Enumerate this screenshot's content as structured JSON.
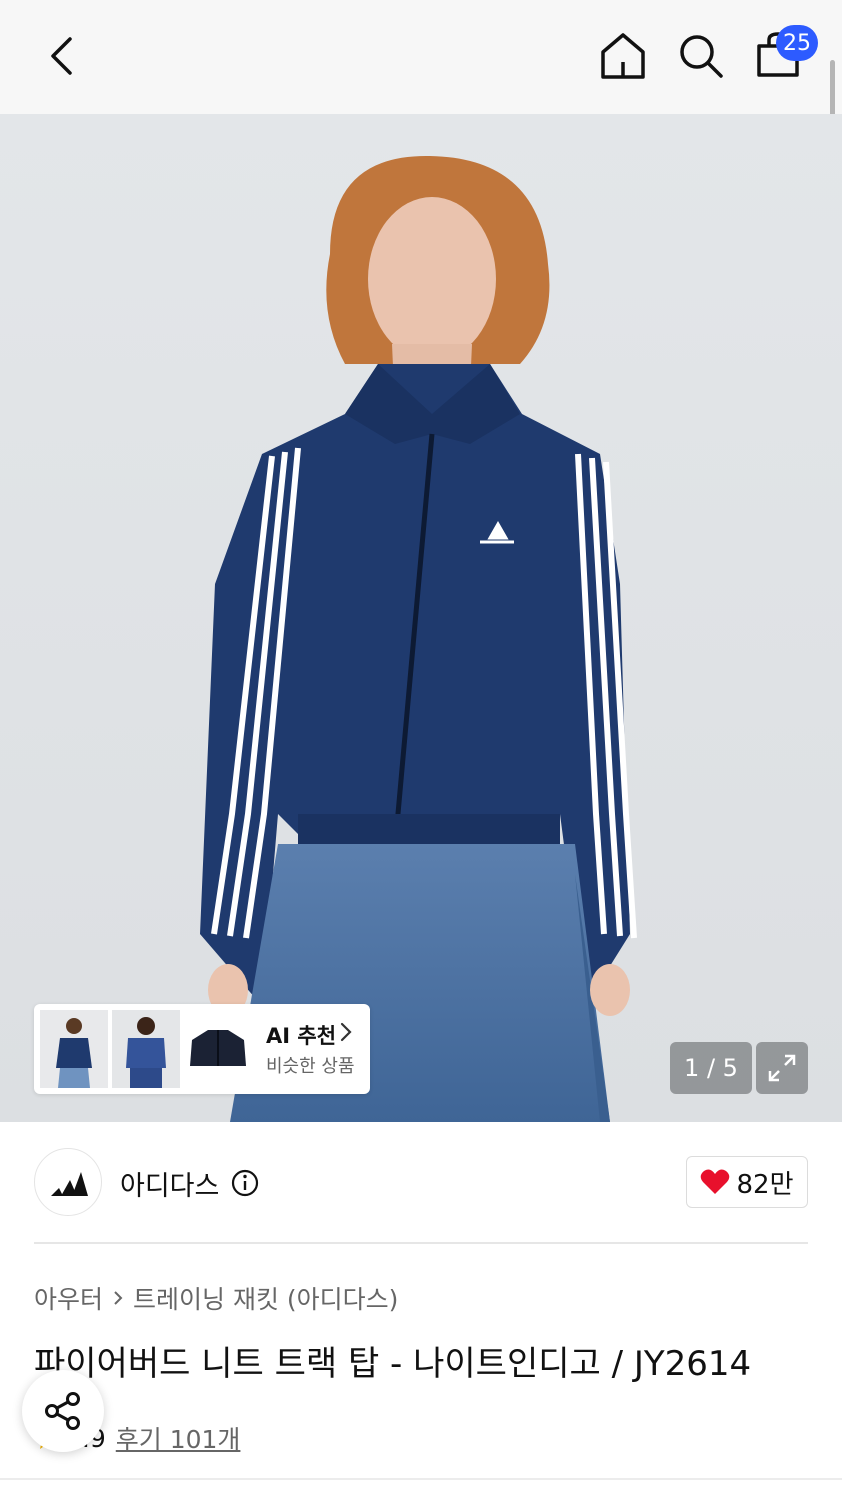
{
  "header": {
    "cart_count": "25"
  },
  "gallery": {
    "counter": "1 / 5",
    "ai_recommend": {
      "title": "AI 추천",
      "subtitle": "비슷한 상품"
    }
  },
  "brand": {
    "name": "아디다스",
    "likes": "82만"
  },
  "breadcrumb": {
    "category": "아우터",
    "subcategory": "트레이닝 재킷 (아디다스)"
  },
  "product": {
    "title": "파이어버드 니트 트랙 탑 - 나이트인디고 / JY2614",
    "rating": "4.9",
    "reviews": "후기 101개"
  },
  "colors": {
    "accent": "#2d5bff",
    "like_heart": "#e8102c",
    "jacket_navy": "#1f3a6e",
    "star": "#f5b400"
  }
}
